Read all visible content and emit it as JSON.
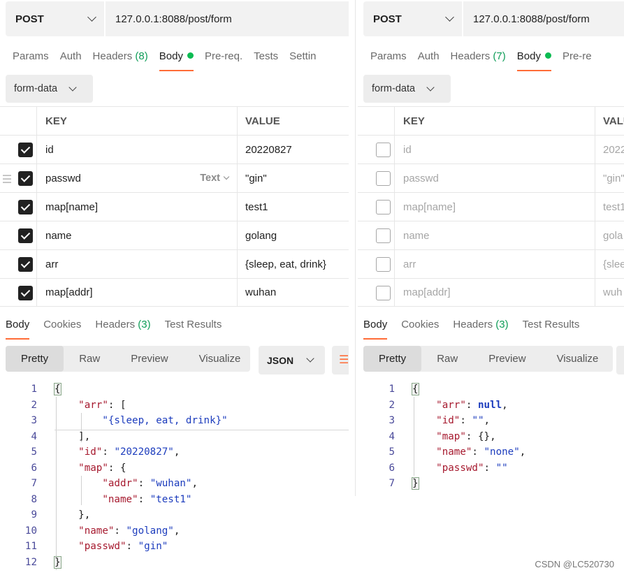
{
  "left": {
    "method": "POST",
    "url": "127.0.0.1:8088/post/form",
    "tabs": [
      {
        "label": "Params"
      },
      {
        "label": "Auth"
      },
      {
        "label": "Headers",
        "count": "(8)"
      },
      {
        "label": "Body"
      },
      {
        "label": "Pre-req."
      },
      {
        "label": "Tests"
      },
      {
        "label": "Settin"
      }
    ],
    "body_type": "form-data",
    "table": {
      "key_header": "KEY",
      "value_header": "VALUE",
      "type_tag": "Text",
      "rows": [
        {
          "key": "id",
          "value": "20220827",
          "checked": true
        },
        {
          "key": "passwd",
          "value": "\"gin\"",
          "checked": true
        },
        {
          "key": "map[name]",
          "value": "test1",
          "checked": true
        },
        {
          "key": "name",
          "value": "golang",
          "checked": true
        },
        {
          "key": "arr",
          "value": "{sleep, eat, drink}",
          "checked": true
        },
        {
          "key": "map[addr]",
          "value": "wuhan",
          "checked": true
        }
      ]
    },
    "response_tabs": [
      {
        "label": "Body"
      },
      {
        "label": "Cookies"
      },
      {
        "label": "Headers",
        "count": "(3)"
      },
      {
        "label": "Test Results"
      }
    ],
    "view_modes": [
      "Pretty",
      "Raw",
      "Preview",
      "Visualize"
    ],
    "format": "JSON",
    "code_lines": [
      "1",
      "2",
      "3",
      "4",
      "5",
      "6",
      "7",
      "8",
      "9",
      "10",
      "11",
      "12"
    ],
    "json": {
      "arr_key": "\"arr\"",
      "arr_item": "\"{sleep, eat, drink}\"",
      "id_key": "\"id\"",
      "id_val": "\"20220827\"",
      "map_key": "\"map\"",
      "addr_key": "\"addr\"",
      "addr_val": "\"wuhan\"",
      "mname_key": "\"name\"",
      "mname_val": "\"test1\"",
      "name_key": "\"name\"",
      "name_val": "\"golang\"",
      "passwd_key": "\"passwd\"",
      "passwd_val": "\"gin\""
    }
  },
  "right": {
    "method": "POST",
    "url": "127.0.0.1:8088/post/form",
    "tabs": [
      {
        "label": "Params"
      },
      {
        "label": "Auth"
      },
      {
        "label": "Headers",
        "count": "(7)"
      },
      {
        "label": "Body"
      },
      {
        "label": "Pre-re"
      }
    ],
    "body_type": "form-data",
    "table": {
      "key_header": "KEY",
      "value_header": "VALU",
      "rows": [
        {
          "key": "id",
          "value": "2022",
          "checked": false
        },
        {
          "key": "passwd",
          "value": "\"gin\"",
          "checked": false
        },
        {
          "key": "map[name]",
          "value": "test1",
          "checked": false
        },
        {
          "key": "name",
          "value": "gola",
          "checked": false
        },
        {
          "key": "arr",
          "value": "{slee",
          "checked": false
        },
        {
          "key": "map[addr]",
          "value": "wuh",
          "checked": false
        }
      ]
    },
    "response_tabs": [
      {
        "label": "Body"
      },
      {
        "label": "Cookies"
      },
      {
        "label": "Headers",
        "count": "(3)"
      },
      {
        "label": "Test Results"
      }
    ],
    "view_modes": [
      "Pretty",
      "Raw",
      "Preview",
      "Visualize"
    ],
    "code_lines": [
      "1",
      "2",
      "3",
      "4",
      "5",
      "6",
      "7"
    ],
    "json": {
      "arr_key": "\"arr\"",
      "arr_val": "null",
      "id_key": "\"id\"",
      "id_val": "\"\"",
      "map_key": "\"map\"",
      "map_val": "{}",
      "name_key": "\"name\"",
      "name_val": "\"none\"",
      "passwd_key": "\"passwd\"",
      "passwd_val": "\"\""
    }
  },
  "watermark": "CSDN @LC520730",
  "colors": {
    "accent": "#ff6c37",
    "active_dot": "#0cbb52",
    "count": "#0f9d58",
    "json_key": "#a6192e",
    "json_string": "#1c3cbd"
  }
}
